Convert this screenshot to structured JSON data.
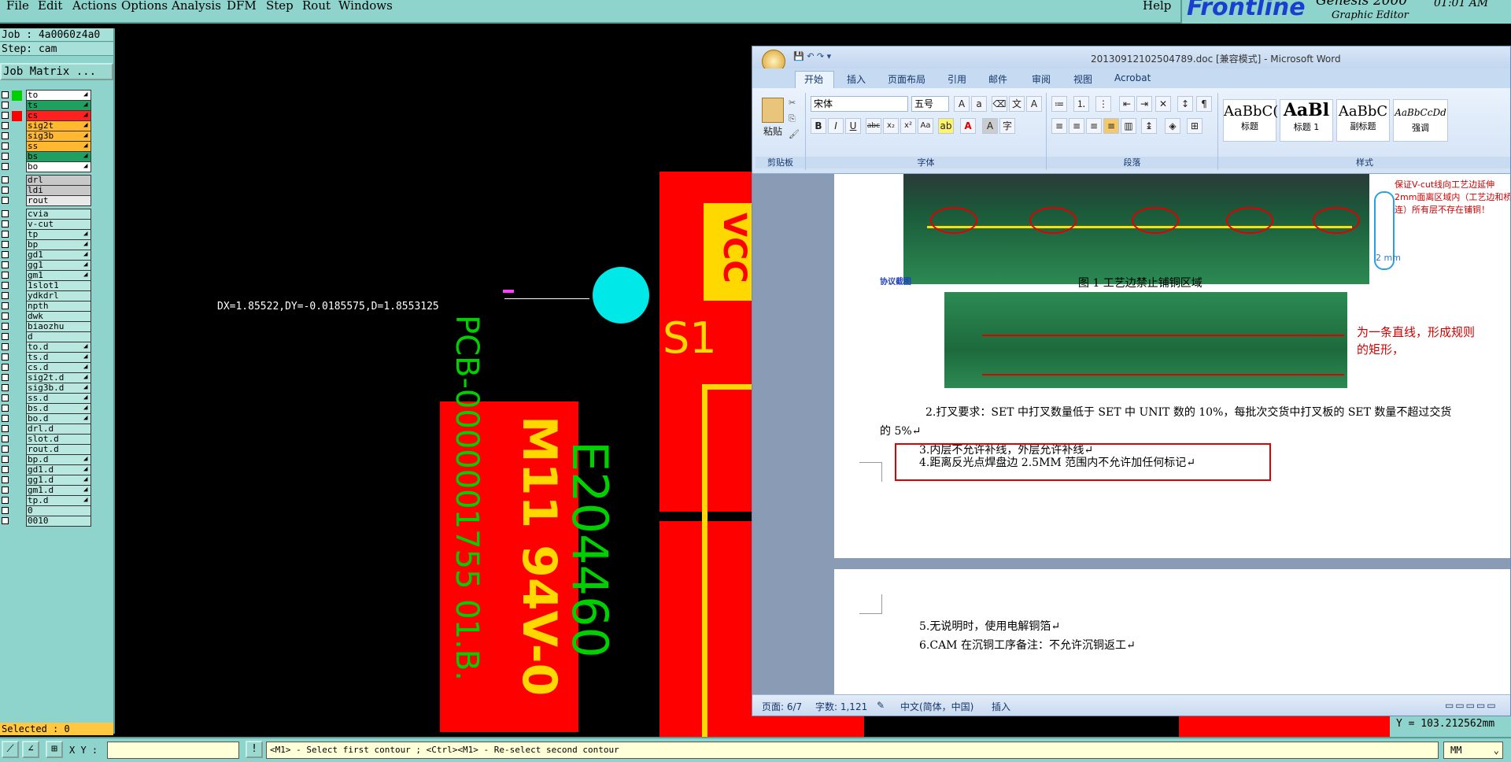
{
  "menubar": {
    "items": [
      "File",
      "Edit",
      "Actions",
      "Options",
      "Analysis",
      "DFM",
      "Step",
      "Rout",
      "Windows"
    ],
    "help": "Help"
  },
  "brand": {
    "name": "Frontline",
    "product": "Genesis 2000",
    "subtitle": "Graphic Editor",
    "time": "01:01 AM"
  },
  "left_panel": {
    "job": "Job : 4a0060z4a0",
    "step": "Step: cam",
    "job_matrix": "Job Matrix ...",
    "layers": [
      {
        "name": "to",
        "color": "#ffffff",
        "swatch": "#00d000",
        "arrow": true
      },
      {
        "name": "ts",
        "color": "#20a060",
        "swatch": "",
        "arrow": true
      },
      {
        "name": "cs",
        "color": "#ff2020",
        "swatch": "#ff0000",
        "arrow": true
      },
      {
        "name": "sig2t",
        "color": "#ffb830",
        "swatch": "",
        "arrow": true
      },
      {
        "name": "sig3b",
        "color": "#ffb830",
        "swatch": "",
        "arrow": true
      },
      {
        "name": "ss",
        "color": "#ffb830",
        "swatch": "",
        "arrow": true
      },
      {
        "name": "bs",
        "color": "#20a060",
        "swatch": "",
        "arrow": true
      },
      {
        "name": "bo",
        "color": "#ffffff",
        "swatch": "",
        "arrow": true
      },
      {
        "name": "drl",
        "color": "#c8c8c8",
        "swatch": "",
        "arrow": false
      },
      {
        "name": "ldi",
        "color": "#c8c8c8",
        "swatch": "",
        "arrow": false
      },
      {
        "name": "rout",
        "color": "#e8e8e8",
        "swatch": "",
        "arrow": false
      },
      {
        "name": "cvia",
        "color": "#b8e8e0",
        "swatch": "",
        "arrow": false
      },
      {
        "name": "v-cut",
        "color": "#b8e8e0",
        "swatch": "",
        "arrow": false
      },
      {
        "name": "tp",
        "color": "#b8e8e0",
        "swatch": "",
        "arrow": true
      },
      {
        "name": "bp",
        "color": "#b8e8e0",
        "swatch": "",
        "arrow": true
      },
      {
        "name": "gd1",
        "color": "#b8e8e0",
        "swatch": "",
        "arrow": true
      },
      {
        "name": "gg1",
        "color": "#b8e8e0",
        "swatch": "",
        "arrow": true
      },
      {
        "name": "gm1",
        "color": "#b8e8e0",
        "swatch": "",
        "arrow": true
      },
      {
        "name": "1slot1",
        "color": "#b8e8e0",
        "swatch": "",
        "arrow": false
      },
      {
        "name": "ydkdrl",
        "color": "#b8e8e0",
        "swatch": "",
        "arrow": false
      },
      {
        "name": "npth",
        "color": "#b8e8e0",
        "swatch": "",
        "arrow": false
      },
      {
        "name": "dwk",
        "color": "#b8e8e0",
        "swatch": "",
        "arrow": false
      },
      {
        "name": "biaozhu",
        "color": "#b8e8e0",
        "swatch": "",
        "arrow": false
      },
      {
        "name": "d",
        "color": "#b8e8e0",
        "swatch": "",
        "arrow": false
      },
      {
        "name": "to.d",
        "color": "#b8e8e0",
        "swatch": "",
        "arrow": true
      },
      {
        "name": "ts.d",
        "color": "#b8e8e0",
        "swatch": "",
        "arrow": true
      },
      {
        "name": "cs.d",
        "color": "#b8e8e0",
        "swatch": "",
        "arrow": true
      },
      {
        "name": "sig2t.d",
        "color": "#b8e8e0",
        "swatch": "",
        "arrow": true
      },
      {
        "name": "sig3b.d",
        "color": "#b8e8e0",
        "swatch": "",
        "arrow": true
      },
      {
        "name": "ss.d",
        "color": "#b8e8e0",
        "swatch": "",
        "arrow": true
      },
      {
        "name": "bs.d",
        "color": "#b8e8e0",
        "swatch": "",
        "arrow": true
      },
      {
        "name": "bo.d",
        "color": "#b8e8e0",
        "swatch": "",
        "arrow": true
      },
      {
        "name": "drl.d",
        "color": "#b8e8e0",
        "swatch": "",
        "arrow": false
      },
      {
        "name": "slot.d",
        "color": "#b8e8e0",
        "swatch": "",
        "arrow": false
      },
      {
        "name": "rout.d",
        "color": "#b8e8e0",
        "swatch": "",
        "arrow": false
      },
      {
        "name": "bp.d",
        "color": "#b8e8e0",
        "swatch": "",
        "arrow": true
      },
      {
        "name": "gd1.d",
        "color": "#b8e8e0",
        "swatch": "",
        "arrow": true
      },
      {
        "name": "gg1.d",
        "color": "#b8e8e0",
        "swatch": "",
        "arrow": true
      },
      {
        "name": "gm1.d",
        "color": "#b8e8e0",
        "swatch": "",
        "arrow": true
      },
      {
        "name": "tp.d",
        "color": "#b8e8e0",
        "swatch": "",
        "arrow": true
      },
      {
        "name": "0",
        "color": "#b8e8e0",
        "swatch": "",
        "arrow": false
      },
      {
        "name": "0010",
        "color": "#b8e8e0",
        "swatch": "",
        "arrow": false
      }
    ],
    "selected": "Selected : 0"
  },
  "canvas": {
    "measure": "DX=1.85522,DY=-0.0185575,D=1.8553125",
    "pcb_text_1": "PCB-0000001755 01.B.",
    "pcb_text_2": "M11 94V-0",
    "pcb_text_3": "E204460",
    "vcc": "VCC",
    "s1": "S1",
    "y_readout": "Y = 103.212562mm"
  },
  "bottom": {
    "xy_label": "X Y :",
    "xy_value": "",
    "prompt": "<M1> - Select first contour ; <Ctrl><M1> - Re-select second contour",
    "units": "MM"
  },
  "word": {
    "title": "20130912102504789.doc [兼容模式] - Microsoft Word",
    "tabs": [
      "开始",
      "插入",
      "页面布局",
      "引用",
      "邮件",
      "审阅",
      "视图",
      "Acrobat"
    ],
    "clipboard": {
      "paste": "粘贴",
      "label": "剪贴板"
    },
    "font": {
      "name": "宋体",
      "size": "五号",
      "label": "字体"
    },
    "paragraph_label": "段落",
    "styles": {
      "label": "样式",
      "items": [
        {
          "sample": "AaBbC(",
          "name": "标题"
        },
        {
          "sample": "AaBl",
          "name": "标题 1"
        },
        {
          "sample": "AaBbC",
          "name": "副标题"
        },
        {
          "sample": "AaBbCcDd",
          "name": "强调"
        }
      ]
    },
    "doc": {
      "image1_note": "保证V-cut线向工艺边延伸2mm面离区域内（工艺边和桥连）所有层不存在铺铜！",
      "image1_dim": "2 mm",
      "image1_callout": "协议截图",
      "fig_caption": "图 1  工艺边禁止铺铜区域",
      "image2_note": "为一条直线，形成规则的矩形，",
      "para2_line1": "2.打叉要求：SET 中打叉数量低于 SET 中 UNIT 数的 10%，每批次交货中打叉板的 SET 数量不超过交货",
      "para2_line2": "的 5%↵",
      "para3": "3.内层不允许补线，外层允许补线↵",
      "para4": "4.距离反光点焊盘边 2.5MM 范围内不允许加任何标记↵",
      "para5": "5.无说明时，使用电解铜箔↵",
      "para6": "6.CAM 在沉铜工序备注：不允许沉铜返工↵"
    },
    "status": {
      "page": "页面: 6/7",
      "words": "字数: 1,121",
      "lang": "中文(简体，中国)",
      "mode": "插入"
    }
  }
}
